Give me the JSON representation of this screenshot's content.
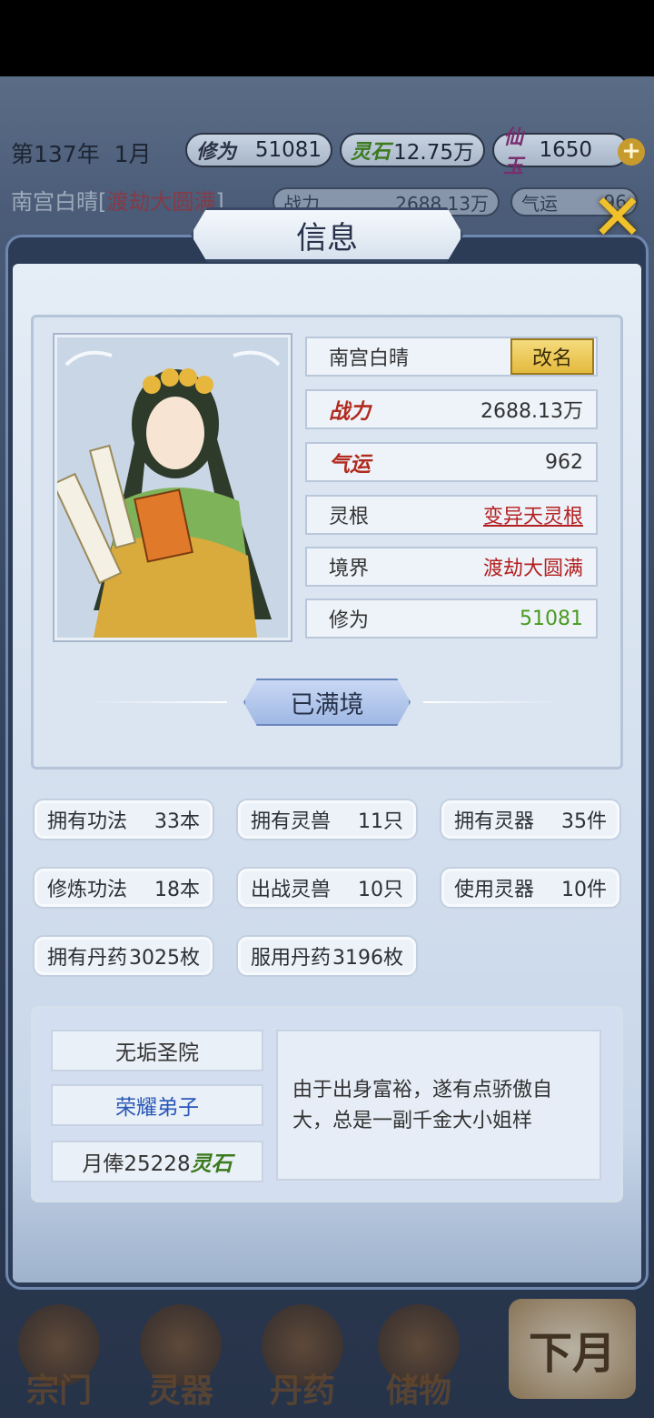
{
  "header": {
    "year": "第137年",
    "month": "1月",
    "resources": [
      {
        "tag": "修为",
        "value": "51081"
      },
      {
        "tag": "灵石",
        "value": "12.75万"
      },
      {
        "tag": "仙玉",
        "value": "1650"
      }
    ],
    "sub": {
      "name": "南宫白晴",
      "realm": "渡劫大圆满",
      "power_tag": "战力",
      "power_value": "2688.13万",
      "luck_tag": "气运",
      "luck_value": "96"
    }
  },
  "dialog": {
    "title": "信息",
    "character": {
      "name": "南宫白晴",
      "rename_label": "改名",
      "stats": [
        {
          "label": "战力",
          "value": "2688.13万"
        },
        {
          "label": "气运",
          "value": "962"
        },
        {
          "label": "灵根",
          "value": "变异天灵根"
        },
        {
          "label": "境界",
          "value": "渡劫大圆满"
        },
        {
          "label": "修为",
          "value": "51081"
        }
      ]
    },
    "status_button": "已满境",
    "counts": [
      {
        "label": "拥有功法",
        "value": "33本"
      },
      {
        "label": "拥有灵兽",
        "value": "11只"
      },
      {
        "label": "拥有灵器",
        "value": "35件"
      },
      {
        "label": "修炼功法",
        "value": "18本"
      },
      {
        "label": "出战灵兽",
        "value": "10只"
      },
      {
        "label": "使用灵器",
        "value": "10件"
      },
      {
        "label": "拥有丹药",
        "value": "3025枚"
      },
      {
        "label": "服用丹药",
        "value": "3196枚"
      }
    ],
    "sect": {
      "name": "无垢圣院",
      "rank": "荣耀弟子",
      "salary_prefix": "月俸25228",
      "salary_unit": "灵石",
      "description": "由于出身富裕，遂有点骄傲自大，总是一副千金大小姐样"
    }
  },
  "nav": {
    "items": [
      "宗门",
      "灵器",
      "丹药",
      "储物"
    ],
    "next_month": "下月"
  },
  "colors": {
    "accent_gold": "#e4ba3e",
    "red_value": "#b42020",
    "green_value": "#4a9a1e",
    "blue_rank": "#2a58b8"
  }
}
